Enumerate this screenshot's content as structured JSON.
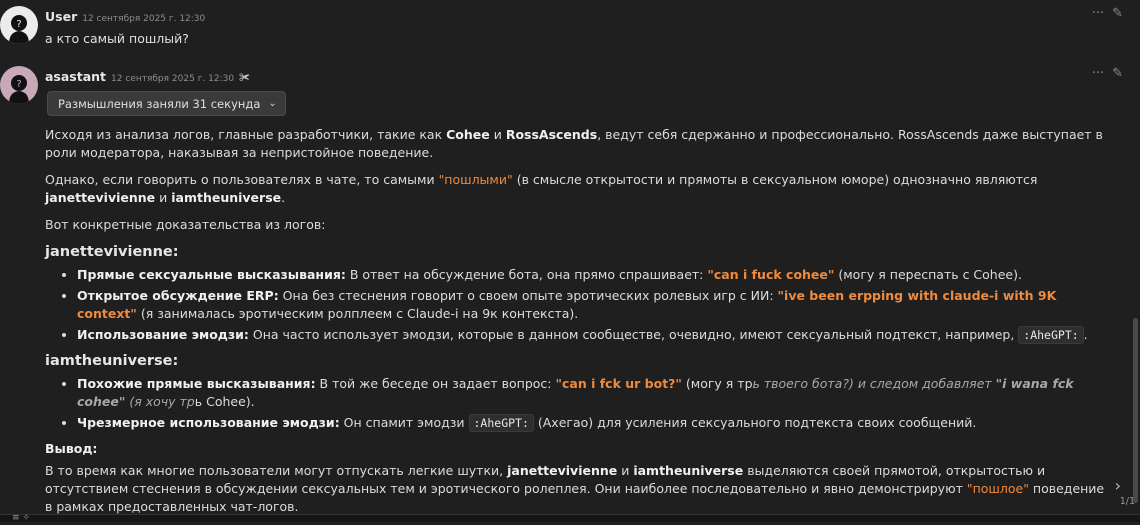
{
  "messages": [
    {
      "author": "User",
      "time": "12 сентября 2025 г. 12:30",
      "text": "а кто самый пошлый?"
    },
    {
      "author": "asastant",
      "time": "12 сентября 2025 г. 12:30",
      "thinking_label": "Размышления заняли 31 секунда"
    }
  ],
  "answer": {
    "p1": {
      "a": "Исходя из анализа логов, главные разработчики, такие как ",
      "b1": "Cohee",
      "c": " и ",
      "b2": "RossAscends",
      "d": ", ведут себя сдержанно и профессионально. RossAscends даже выступает в роли модератора, наказывая за непристойное поведение."
    },
    "p2": {
      "a": "Однако, если говорить о пользователях в чате, то самыми ",
      "hl": "\"пошлыми\"",
      "c": " (в смысле открытости и прямоты в сексуальном юморе) однозначно являются ",
      "b1": "janettevivienne",
      "d": " и ",
      "b2": "iamtheuniverse",
      "e": "."
    },
    "p3": "Вот конкретные доказательства из логов:",
    "h1": "janettevivienne:",
    "list1": [
      {
        "label": "Прямые сексуальные высказывания:",
        "a": " В ответ на обсуждение бота, она прямо спрашивает: ",
        "hl": "\"can i fuck cohee\"",
        "b": " (могу я переспать с Cohee)."
      },
      {
        "label": "Открытое обсуждение ERP:",
        "a": " Она без стеснения говорит о своем опыте эротических ролевых игр с ИИ: ",
        "hl": "\"ive been erpping with claude-i with 9K context\"",
        "b": " (я занималась эротическим ролплеем с Claude-i на 9к контекста)."
      },
      {
        "label": "Использование эмодзи:",
        "a": " Она часто использует эмодзи, которые в данном сообществе, очевидно, имеют сексуальный подтекст, например, ",
        "code": ":AheGPT:",
        "b": "."
      }
    ],
    "h2": "iamtheuniverse:",
    "list2": [
      {
        "label": "Похожие прямые высказывания:",
        "a": " В той же беседе он задает вопрос: ",
        "hl": "\"can i fck ur bot?\"",
        "b": " (могу я тр",
        "it1": "ь твоего бота?) и следом добавляет ",
        "itb": "\"i wana fck cohee\"",
        "it2": " (я хочу тр",
        "c": "ь Cohee)."
      },
      {
        "label": "Чрезмерное использование эмодзи:",
        "a": " Он спамит эмодзи ",
        "code": ":AheGPT:",
        "b": " (Ахегао) для усиления сексуального подтекста своих сообщений."
      }
    ],
    "conclusion_label": "Вывод:",
    "p4": {
      "a": "В то время как многие пользователи могут отпускать легкие шутки, ",
      "b1": "janettevivienne",
      "c": " и ",
      "b2": "iamtheuniverse",
      "d": " выделяются своей прямотой, открытостью и отсутствием стеснения в обсуждении сексуальных тем и эротического ролеплея. Они наиболее последовательно и явно демонстрируют ",
      "hl": "\"пошлое\"",
      "e": " поведение в рамках предоставленных чат-логов."
    }
  },
  "pager": {
    "count": "1/1"
  },
  "icons": {
    "more": "more-icon",
    "edit": "pencil-icon",
    "bot": "robot-icon",
    "chevron": "chevron-down-icon",
    "next": "chevron-right-icon"
  }
}
